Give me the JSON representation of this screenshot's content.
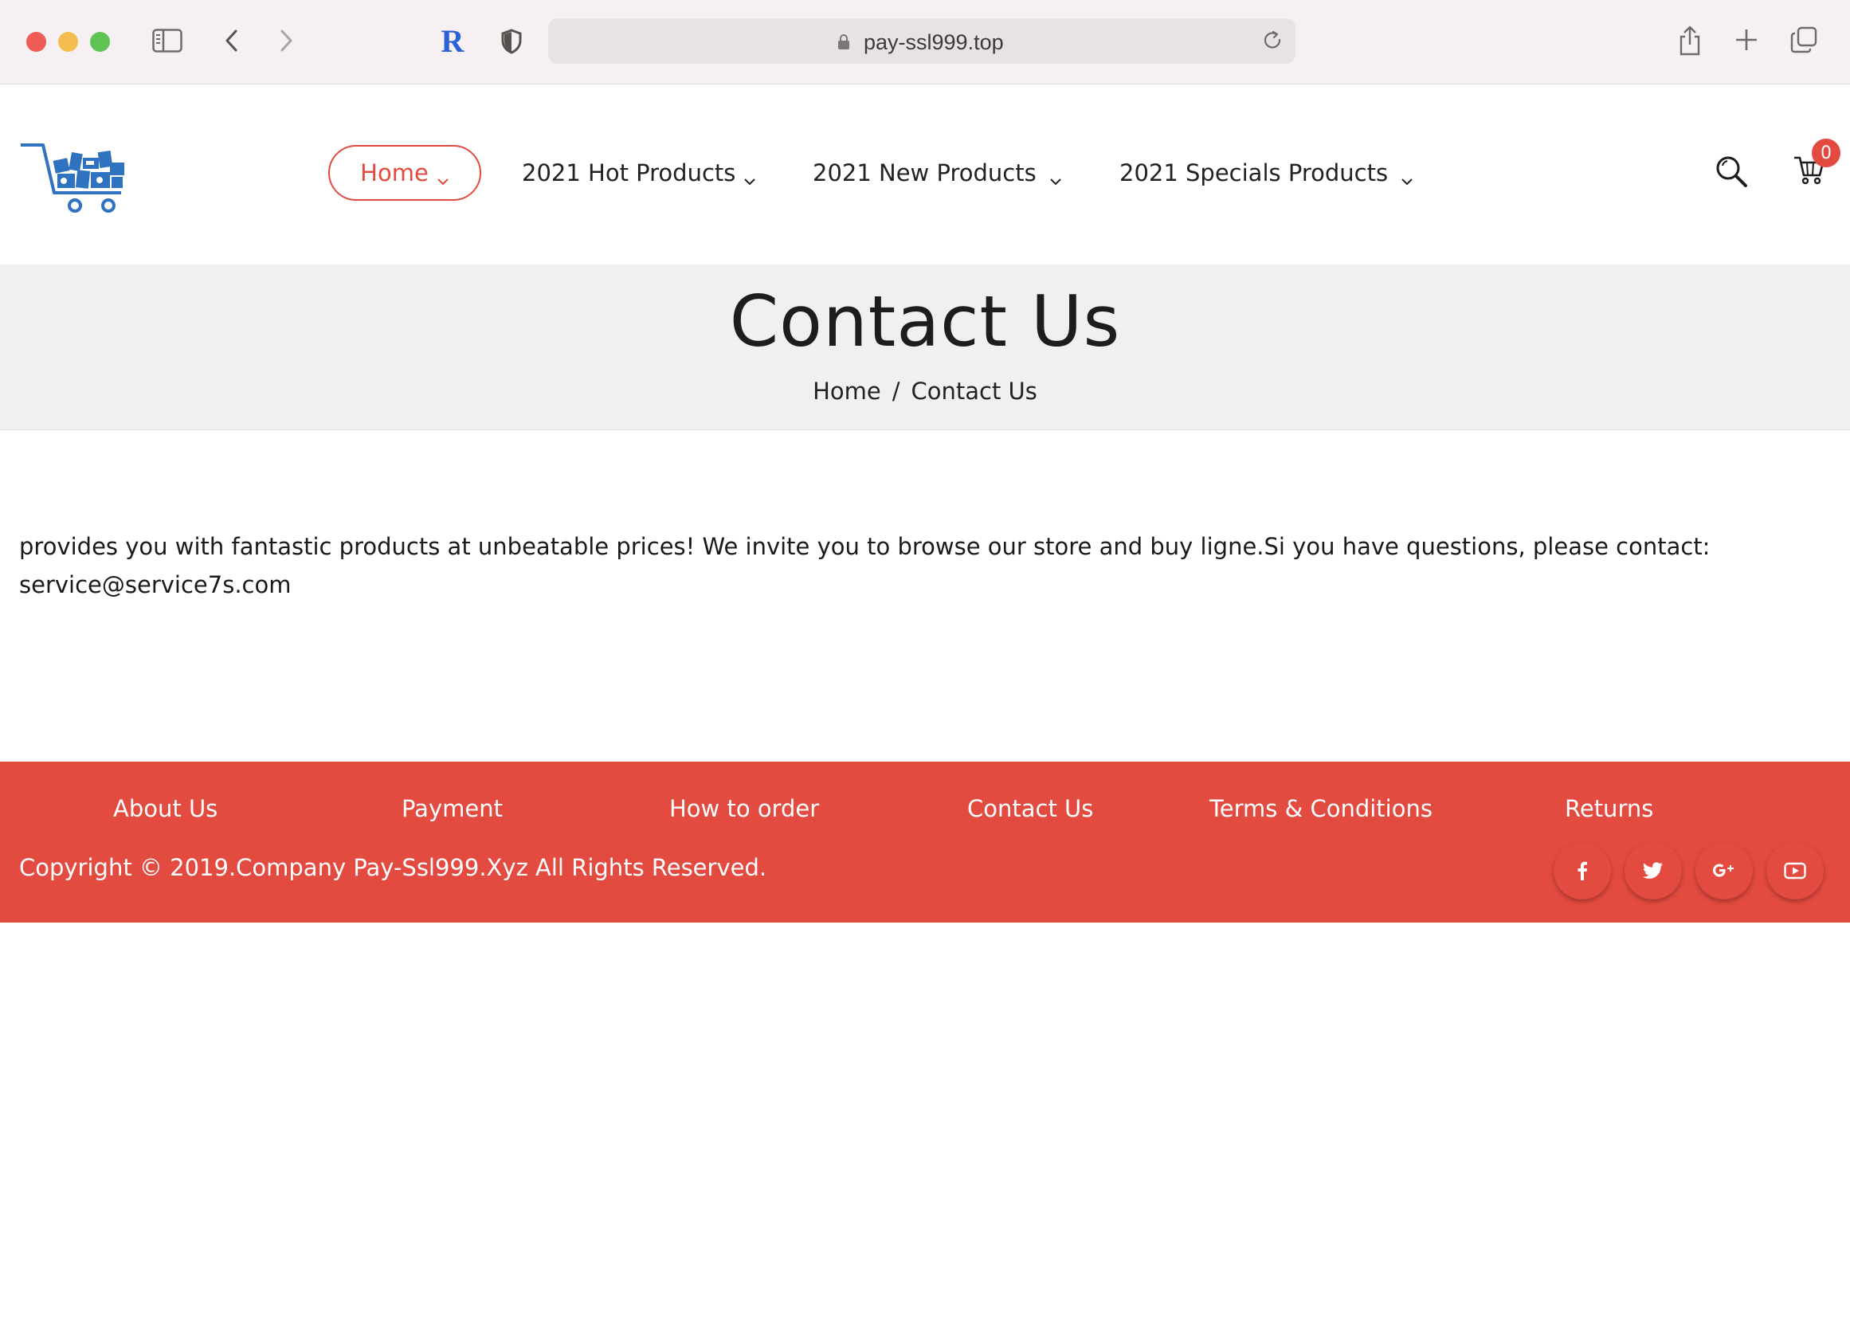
{
  "browser": {
    "url": "pay-ssl999.top",
    "extension_letter": "R"
  },
  "nav": {
    "home": "Home",
    "hot": "2021 Hot Products",
    "new": "2021 New Products",
    "specials": "2021 Specials Products",
    "cart_count": "0"
  },
  "page": {
    "title": "Contact Us",
    "breadcrumb_home": "Home",
    "breadcrumb_sep": "/",
    "breadcrumb_current": "Contact Us"
  },
  "content": {
    "line1": "provides you with fantastic products at unbeatable prices! We invite you to browse our store and buy ligne.Si you have questions, please contact:",
    "line2": "service@service7s.com"
  },
  "footer": {
    "links": [
      "About Us",
      "Payment",
      "How to order",
      "Contact Us",
      "Terms & Conditions",
      "Returns"
    ],
    "copyright": "Copyright © 2019.Company Pay-Ssl999.Xyz All Rights Reserved.",
    "social": [
      "facebook-icon",
      "twitter-icon",
      "google-plus-icon",
      "youtube-icon"
    ]
  },
  "colors": {
    "accent": "#e34a40",
    "band": "#f0f0f0",
    "logo_blue": "#2f72c0"
  }
}
